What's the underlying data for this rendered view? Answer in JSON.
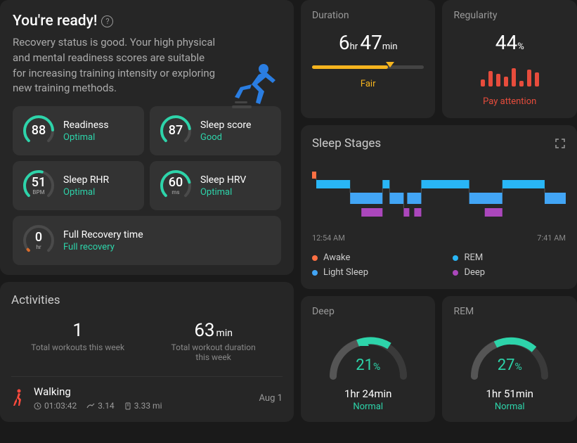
{
  "readiness": {
    "title": "You're ready!",
    "description": "Recovery status is good.  Your high physical and mental readiness scores are suitable for increasing training intensity or exploring new training methods.",
    "metrics": [
      {
        "value": "88",
        "unit": "",
        "label": "Readiness",
        "status": "Optimal",
        "statusClass": "status-optimal",
        "arcColor": "#2dd4aa",
        "arcPct": 0.82
      },
      {
        "value": "87",
        "unit": "",
        "label": "Sleep score",
        "status": "Good",
        "statusClass": "status-good",
        "arcColor": "#2dd4aa",
        "arcPct": 0.8
      },
      {
        "value": "51",
        "unit": "BPM",
        "label": "Sleep RHR",
        "status": "Optimal",
        "statusClass": "status-optimal",
        "arcColor": "#2dd4aa",
        "arcPct": 0.55
      },
      {
        "value": "60",
        "unit": "ms",
        "label": "Sleep HRV",
        "status": "Optimal",
        "statusClass": "status-optimal",
        "arcColor": "#2dd4aa",
        "arcPct": 0.78
      },
      {
        "value": "0",
        "unit": "hr",
        "label": "Full Recovery time",
        "status": "Full recovery",
        "statusClass": "status-recovery",
        "arcColor": "#d96b2b",
        "arcPct": 0.02,
        "full": true
      }
    ]
  },
  "activities": {
    "title": "Activities",
    "totalWorkouts": "1",
    "totalWorkoutsLabel": "Total workouts this week",
    "totalDuration": "63",
    "totalDurationUnit": "min",
    "totalDurationLabel": "Total workout duration this week",
    "item": {
      "name": "Walking",
      "date": "Aug 1",
      "time": "01:03:42",
      "pace": "3.14",
      "distance": "3.33 mi"
    }
  },
  "duration": {
    "title": "Duration",
    "hours": "6",
    "minutes": "47",
    "status": "Fair",
    "fillPct": 68
  },
  "regularity": {
    "title": "Regularity",
    "value": "44",
    "status": "Pay attention",
    "bars": [
      10,
      22,
      18,
      14,
      26,
      8,
      24,
      20
    ]
  },
  "sleepStages": {
    "title": "Sleep Stages",
    "start": "12:54 AM",
    "end": "7:41 AM",
    "legend": {
      "awake": "Awake",
      "light": "Light Sleep",
      "rem": "REM",
      "deep": "Deep"
    }
  },
  "deep": {
    "title": "Deep",
    "pct": "21",
    "dur": "1hr 24min",
    "status": "Normal"
  },
  "rem": {
    "title": "REM",
    "pct": "27",
    "dur": "1hr 51min",
    "status": "Normal"
  },
  "chart_data": {
    "sleep_stages_timeline": {
      "type": "timeline",
      "start": "12:54 AM",
      "end": "7:41 AM",
      "stages": [
        "Awake",
        "REM",
        "Light Sleep",
        "Deep"
      ],
      "note": "Hypnogram showing transitions between Awake, REM, Light, Deep across the night"
    },
    "regularity_bars": {
      "type": "bar",
      "values": [
        10,
        22,
        18,
        14,
        26,
        8,
        24,
        20
      ],
      "note": "relative heights only, no axis shown"
    }
  }
}
